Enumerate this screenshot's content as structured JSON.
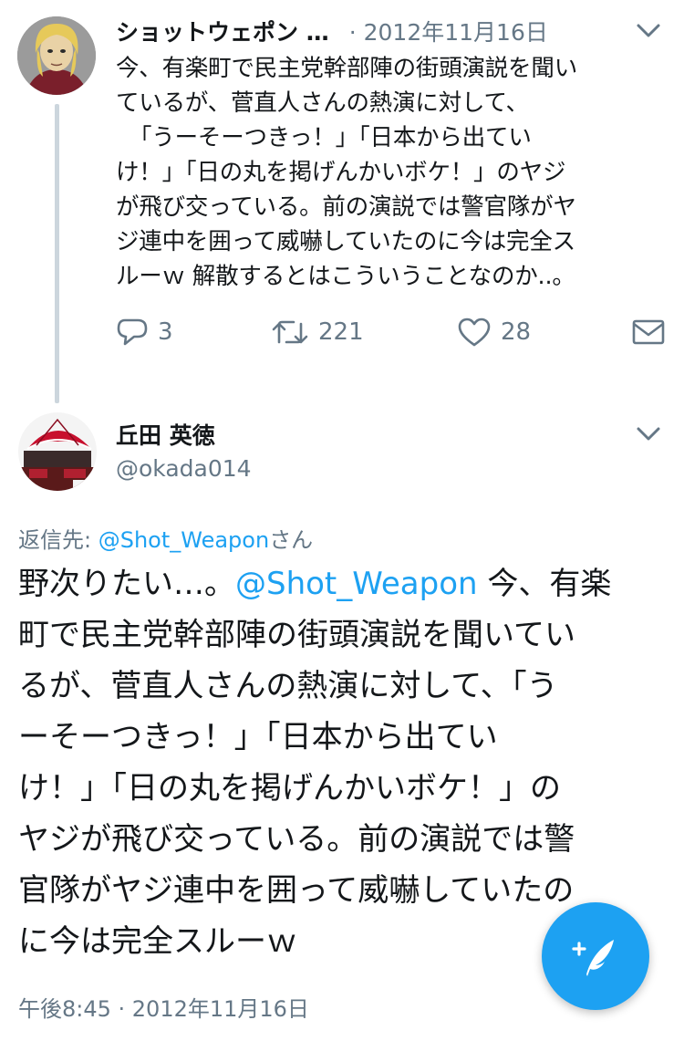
{
  "parent_tweet": {
    "display_name": "ショットウェポン …",
    "date": "· 2012年11月16日",
    "text_lines": [
      "今、有楽町で民主党幹部陣の街頭演説を聞い",
      "ているが、菅直人さんの熱演に対して、",
      "「うーそーつきっ！」「日本から出てい",
      "け！」「日の丸を掲げんかいボケ！」のヤジ",
      "が飛び交っている。前の演説では警官隊がヤ",
      "ジ連中を囲って威嚇していたのに今は完全ス",
      "ルーｗ 解散するとはこういうことなのか..。"
    ],
    "actions": {
      "reply_count": "3",
      "retweet_count": "221",
      "like_count": "28"
    }
  },
  "reply_tweet": {
    "display_name": "丘田 英徳",
    "handle": "@okada014",
    "replying_to_prefix": "返信先: ",
    "replying_to_mention": "@Shot_Weapon",
    "replying_to_suffix": "さん",
    "body": {
      "line1_prefix": "野次りたい…。",
      "line1_mention": "@Shot_Weapon",
      "line1_suffix": " 今、有楽",
      "lines": [
        "町で民主党幹部陣の街頭演説を聞いてい",
        "るが、菅直人さんの熱演に対して、「う",
        "ーそーつきっ！」「日本から出てい",
        "け！」「日の丸を掲げんかいボケ！」の",
        "ヤジが飛び交っている。前の演説では警",
        "官隊がヤジ連中を囲って威嚇していたの",
        "に今は完全スルーｗ"
      ]
    },
    "timestamp": "午後8:45 · 2012年11月16日"
  },
  "icons": {
    "reply": "reply-icon",
    "retweet": "retweet-icon",
    "like": "heart-icon",
    "dm": "envelope-icon",
    "more": "chevron-down-icon",
    "compose": "compose-tweet-icon"
  },
  "colors": {
    "accent": "#1da1f2",
    "secondary_text": "#657786",
    "thread_line": "#ccd6dd"
  }
}
